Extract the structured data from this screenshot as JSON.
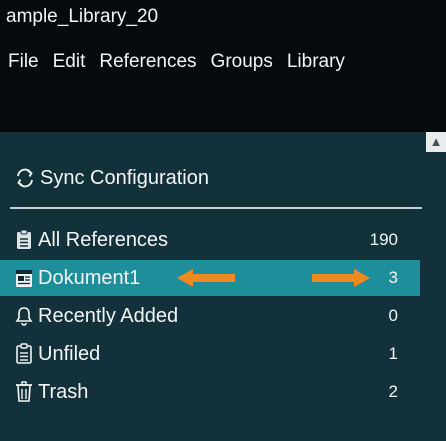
{
  "window": {
    "title": "ample_Library_20"
  },
  "menu": {
    "items": [
      {
        "label": "File"
      },
      {
        "label": "Edit"
      },
      {
        "label": "References"
      },
      {
        "label": "Groups"
      },
      {
        "label": "Library"
      }
    ]
  },
  "sync": {
    "label": "Sync Configuration",
    "icon": "sync-icon"
  },
  "library": {
    "rows": [
      {
        "label": "All References",
        "count": "190",
        "icon": "clipboard-icon"
      },
      {
        "label": "Dokument1",
        "count": "3",
        "icon": "document-group-icon",
        "selected": true
      },
      {
        "label": "Recently Added",
        "count": "0",
        "icon": "bell-icon"
      },
      {
        "label": "Unfiled",
        "count": "1",
        "icon": "clipboard-icon"
      },
      {
        "label": "Trash",
        "count": "2",
        "icon": "trash-icon"
      }
    ]
  },
  "annotations": {
    "arrow_color": "#f08a1e"
  },
  "colors": {
    "selected_row": "#1e8f9a",
    "panel_bg": "#13313b",
    "menubar_bg": "#050a0c"
  }
}
